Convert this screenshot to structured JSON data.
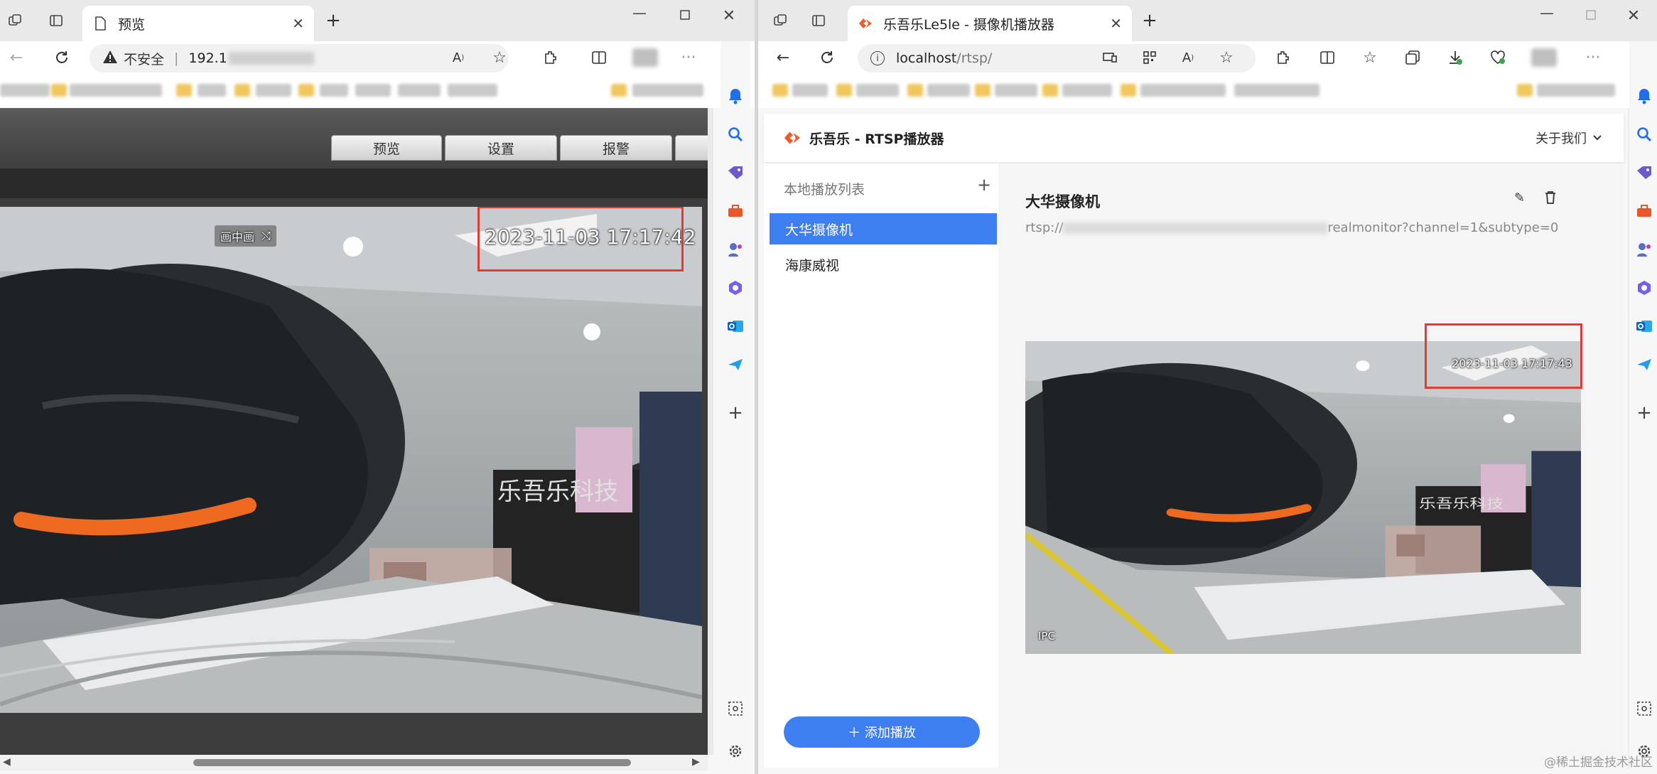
{
  "left_window": {
    "tab_title": "预览",
    "security_label": "不安全",
    "address_prefix": "192.1",
    "ipc_tabs": [
      "预览",
      "设置",
      "报警"
    ],
    "pip_label": "画中画",
    "osd_time": "2023-11-03 17:17:42"
  },
  "right_window": {
    "tab_title": "乐吾乐Le5le - 摄像机播放器",
    "address_host": "localhost",
    "address_path": "/rtsp/",
    "app_title": "乐吾乐 - RTSP播放器",
    "about_menu": "关于我们",
    "playlist_title": "本地播放列表",
    "playlist_add": "+",
    "playlist": [
      {
        "label": "大华摄像机",
        "selected": true
      },
      {
        "label": "海康威视",
        "selected": false
      }
    ],
    "camera_name": "大华摄像机",
    "rtsp_prefix": "rtsp://",
    "rtsp_suffix": "realmonitor?channel=1&subtype=0",
    "osd_time": "2023-11-03 17:17:43",
    "osd_label": "IPC",
    "add_button": "＋  添加播放"
  },
  "logo_text": "乐吾乐科技",
  "watermark": "@稀土掘金技术社区",
  "colors": {
    "accent": "#4080f0",
    "highlight": "#e53935",
    "brand": "#f05a28"
  },
  "icons": [
    "sidebar-bell-icon",
    "sidebar-search-icon",
    "sidebar-tag-icon",
    "sidebar-toolbox-icon",
    "sidebar-person-icon",
    "sidebar-office-icon",
    "sidebar-outlook-icon",
    "sidebar-send-icon",
    "sidebar-add-icon",
    "sidebar-settings-icon"
  ]
}
